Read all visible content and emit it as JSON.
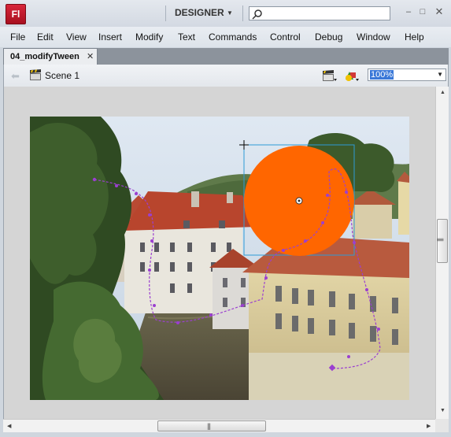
{
  "app": {
    "logo_text": "Fl",
    "workspace": "DESIGNER",
    "search_placeholder": "",
    "window_controls": [
      "minimize-icon",
      "restore-icon",
      "close-icon"
    ]
  },
  "menu": {
    "items": [
      "File",
      "Edit",
      "View",
      "Insert",
      "Modify",
      "Text",
      "Commands",
      "Control",
      "Debug",
      "Window",
      "Help"
    ]
  },
  "document": {
    "tab_label": "04_modifyTween"
  },
  "edit_bar": {
    "scene_label": "Scene 1",
    "zoom": "100%"
  },
  "stage": {
    "photo_subject": "Prague canal with red-roofed buildings and trees",
    "tween_object": {
      "shape": "circle",
      "fill": "#FF6600"
    },
    "motion_path_color": "#9B3FD0",
    "selection_box_color": "#2E9BD6"
  },
  "colors": {
    "accent": "#3a78d8",
    "logo": "#c8182c",
    "circle": "#FF6600"
  }
}
